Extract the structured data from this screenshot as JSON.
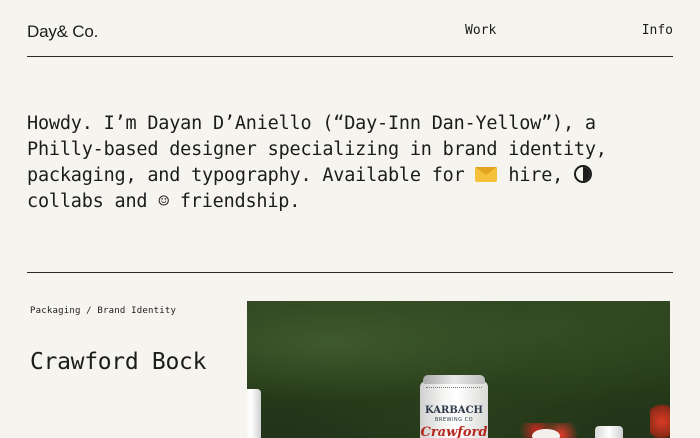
{
  "header": {
    "logo": "Day& Co.",
    "nav": {
      "work": "Work",
      "info": "Info"
    }
  },
  "intro": {
    "part1": "Howdy. I’m Dayan D’Aniello (“Day-Inn Dan-Yellow”), a Philly-based designer specializing in brand identity, packaging, and typography. Available for ",
    "part2": " hire, ",
    "part3": " collabs and ",
    "smile": "☺",
    "part4": " friendship."
  },
  "project": {
    "tags": "Packaging / Brand Identity",
    "title": "Crawford Bock",
    "image": {
      "can_brand": "KARBACH",
      "can_sub": "BREWING CO",
      "can_name": "Crawford"
    }
  },
  "colors": {
    "background": "#f6f4ef",
    "text": "#1c1c1c",
    "image_green": "#2f4420"
  },
  "icons": [
    "envelope-icon",
    "half-moon-icon",
    "smiley-icon"
  ]
}
